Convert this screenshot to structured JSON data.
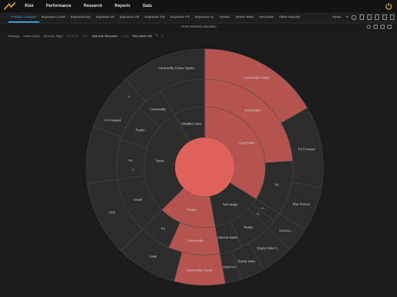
{
  "menu": {
    "items": [
      "Risk",
      "Performance",
      "Research",
      "Reports",
      "Data"
    ]
  },
  "tabs": {
    "items": [
      "Portfolio Analysis",
      "Exposure Limits",
      "Exposure EQ",
      "Exposure IR",
      "Exposure CR",
      "Exposure CM",
      "Exposure FX",
      "Exposure VL",
      "Greeks",
      "Stress Tests",
      "Securities",
      "Other Reports"
    ],
    "active_index": 0,
    "views_label": "Views"
  },
  "subtitle": "Gross Notional Allocation",
  "filters": {
    "items": [
      {
        "text": "Strategy",
        "style": "normal"
      },
      {
        "text": "Asset Class",
        "style": "normal"
      },
      {
        "text": "Security Type",
        "style": "normal"
      },
      {
        "text": "Fund L/E",
        "style": "dim"
      },
      {
        "text": "Size",
        "style": "dim"
      },
      {
        "text": "Notional Allocation",
        "style": "val"
      },
      {
        "text": "Color",
        "style": "dim"
      },
      {
        "text": "P&A (80% ID)",
        "style": "val"
      }
    ]
  },
  "colors": {
    "accent": "#37a7e6",
    "segment_dark": "#2c2c2c",
    "segment_highlight": "#b5544f",
    "center": "#e0605a"
  },
  "chart_data": {
    "type": "sunburst",
    "title": "Gross Notional Allocation",
    "levels": [
      "Strategy",
      "Asset Class",
      "Security Type"
    ],
    "hierarchy": [
      {
        "name": "Carry/Yield",
        "highlight": true,
        "children": [
          {
            "name": "Commodity",
            "highlight": true,
            "children": [
              {
                "name": "Commodity Future",
                "highlight": true
              }
            ]
          },
          {
            "name": "FX",
            "children": [
              {
                "name": "FX Forward"
              },
              {
                "name": "Risk Premia"
              }
            ]
          }
        ]
      },
      {
        "name": "Tail Hedge",
        "children": [
          {
            "name": "Equity",
            "children": [
              {
                "name": "Equity Index F..."
              },
              {
                "name": "Equity Index"
              },
              {
                "name": "Risk Prm"
              }
            ]
          },
          {
            "name": "Interest Rates",
            "children": [
              {
                "name": "Inv"
              }
            ]
          },
          {
            "name": "Li..."
          },
          {
            "name": "M..."
          }
        ]
      },
      {
        "name": "Timing",
        "highlight": true,
        "children": [
          {
            "name": "Commodity",
            "highlight": true,
            "children": [
              {
                "name": "Commodity Future",
                "highlight": true
              }
            ]
          },
          {
            "name": "FX",
            "children": [
              {
                "name": "Cash"
              }
            ]
          }
        ]
      },
      {
        "name": "Trend",
        "children": [
          {
            "name": "Credit",
            "children": [
              {
                "name": "CDS"
              }
            ]
          },
          {
            "name": "FX",
            "children": [
              {
                "name": "FX Forward"
              }
            ]
          },
          {
            "name": "Equity",
            "children": []
          },
          {
            "name": "Commodity",
            "children": [
              {
                "name": "Commodity Future Option"
              }
            ]
          }
        ]
      },
      {
        "name": "Volatility Carry",
        "children": []
      }
    ],
    "labels": {
      "carry": "Carry/Yield",
      "trend": "Trend",
      "timing": "Timing",
      "tail": "Tail Hedge",
      "vol": "Volatility Carry",
      "commodity": "Commodity",
      "fx": "FX",
      "credit": "Credit",
      "equity": "Equity",
      "interest_rates": "Interest Rates",
      "li": "Li...",
      "m": "M...",
      "cf": "Commodity Future",
      "cfo": "Commodity Future Option",
      "fx_forward": "FX Forward",
      "risk_premia": "Risk Premia",
      "cds": "CDS",
      "cash": "Cash",
      "equity_index_f": "Equity Index F...",
      "equity_index": "Equity Index",
      "risk_prm": "Risk Prm",
      "inv": "Inv",
      "commo": "Commo...",
      "comm": "Comm",
      "c": "C",
      "e": "E",
      "fu": "Fu...",
      "ye": "Ye...",
      "li2": "Li..."
    }
  }
}
